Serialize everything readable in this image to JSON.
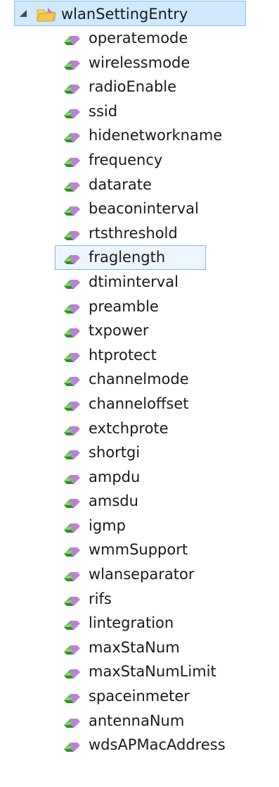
{
  "tree": {
    "root": {
      "label": "wlanSettingEntry",
      "expanded": true,
      "icon": "folder-open-icon",
      "expander_icon": "tree-expanded-triangle-icon"
    },
    "child_icon": "leaf-node-icon",
    "selected_item": "fraglength",
    "children": [
      {
        "label": "operatemode"
      },
      {
        "label": "wirelessmode"
      },
      {
        "label": "radioEnable"
      },
      {
        "label": "ssid"
      },
      {
        "label": "hidenetworkname"
      },
      {
        "label": "frequency"
      },
      {
        "label": "datarate"
      },
      {
        "label": "beaconinterval"
      },
      {
        "label": "rtsthreshold"
      },
      {
        "label": "fraglength"
      },
      {
        "label": "dtiminterval"
      },
      {
        "label": "preamble"
      },
      {
        "label": "txpower"
      },
      {
        "label": "htprotect"
      },
      {
        "label": "channelmode"
      },
      {
        "label": "channeloffset"
      },
      {
        "label": "extchprote"
      },
      {
        "label": "shortgi"
      },
      {
        "label": "ampdu"
      },
      {
        "label": "amsdu"
      },
      {
        "label": "igmp"
      },
      {
        "label": "wmmSupport"
      },
      {
        "label": "wlanseparator"
      },
      {
        "label": "rifs"
      },
      {
        "label": "lintegration"
      },
      {
        "label": "maxStaNum"
      },
      {
        "label": "maxStaNumLimit"
      },
      {
        "label": "spaceinmeter"
      },
      {
        "label": "antennaNum"
      },
      {
        "label": "wdsAPMacAddress"
      }
    ]
  },
  "colors": {
    "root_highlight": "#cfe8fb",
    "root_border": "#80c4ef",
    "selected_bg": "#eef6fd",
    "selected_border": "#7db9e6",
    "folder_yellow": "#f6d55c",
    "leaf_green": "#3ea33b",
    "leaf_purple": "#b07ac8"
  }
}
